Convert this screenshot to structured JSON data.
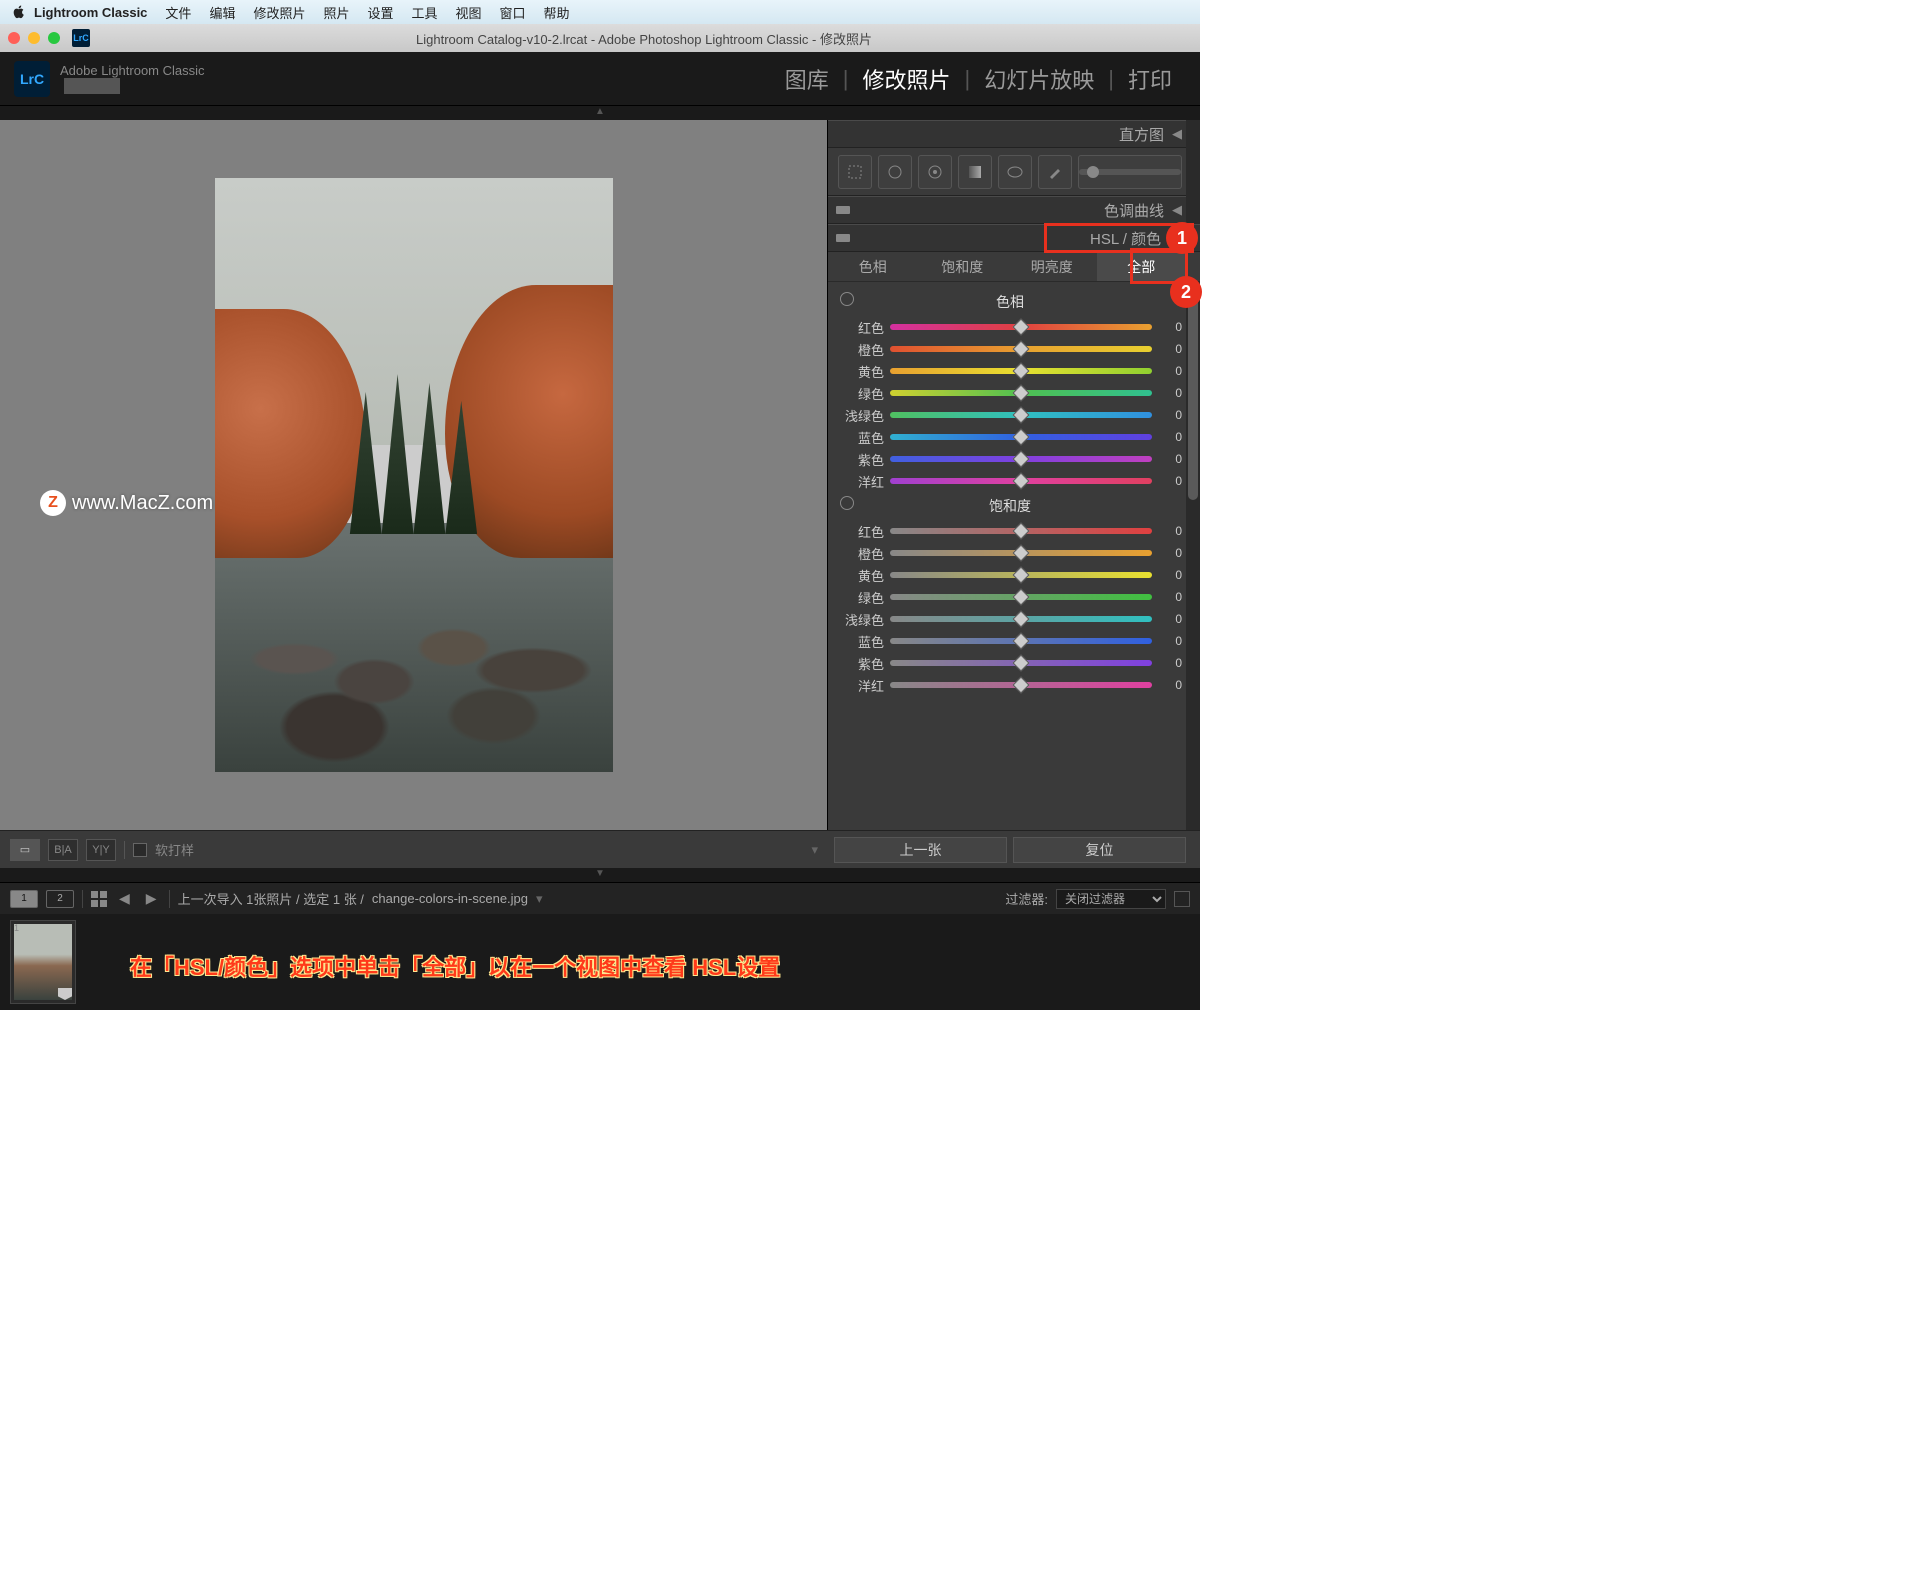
{
  "menubar": {
    "app": "Lightroom Classic",
    "items": [
      "文件",
      "编辑",
      "修改照片",
      "照片",
      "设置",
      "工具",
      "视图",
      "窗口",
      "帮助"
    ]
  },
  "window": {
    "title": "Lightroom Catalog-v10-2.lrcat - Adobe Photoshop Lightroom Classic - 修改照片",
    "brand": "Adobe Lightroom Classic",
    "logo": "LrC"
  },
  "modules": {
    "items": [
      {
        "label": "图库",
        "active": false
      },
      {
        "label": "修改照片",
        "active": true
      },
      {
        "label": "幻灯片放映",
        "active": false
      },
      {
        "label": "打印",
        "active": false
      }
    ]
  },
  "rightPanel": {
    "histogram": "直方图",
    "toneCurve": "色调曲线",
    "hslHeader": "HSL / 颜色",
    "tabs": [
      {
        "key": "hue",
        "label": "色相"
      },
      {
        "key": "sat",
        "label": "饱和度"
      },
      {
        "key": "lum",
        "label": "明亮度"
      },
      {
        "key": "all",
        "label": "全部",
        "active": true
      }
    ],
    "hueGroup": "色相",
    "satGroup": "饱和度",
    "colors": [
      {
        "key": "red",
        "label": "红色",
        "val": 0
      },
      {
        "key": "orange",
        "label": "橙色",
        "val": 0
      },
      {
        "key": "yellow",
        "label": "黄色",
        "val": 0
      },
      {
        "key": "green",
        "label": "绿色",
        "val": 0
      },
      {
        "key": "aqua",
        "label": "浅绿色",
        "val": 0
      },
      {
        "key": "blue",
        "label": "蓝色",
        "val": 0
      },
      {
        "key": "purple",
        "label": "紫色",
        "val": 0
      },
      {
        "key": "magenta",
        "label": "洋红",
        "val": 0
      }
    ]
  },
  "toolbar": {
    "softProof": "软打样",
    "prev": "上一张",
    "reset": "复位"
  },
  "filmstripHeader": {
    "path": "上一次导入   1张照片 / 选定 1 张 /",
    "filename": "change-colors-in-scene.jpg",
    "filterLabel": "过滤器:",
    "filterValue": "关闭过滤器"
  },
  "annotations": {
    "badge1": "1",
    "badge2": "2",
    "caption": "在「HSL/颜色」选项中单击「全部」以在一个视图中查看 HSL设置"
  },
  "watermark": "www.MacZ.com"
}
